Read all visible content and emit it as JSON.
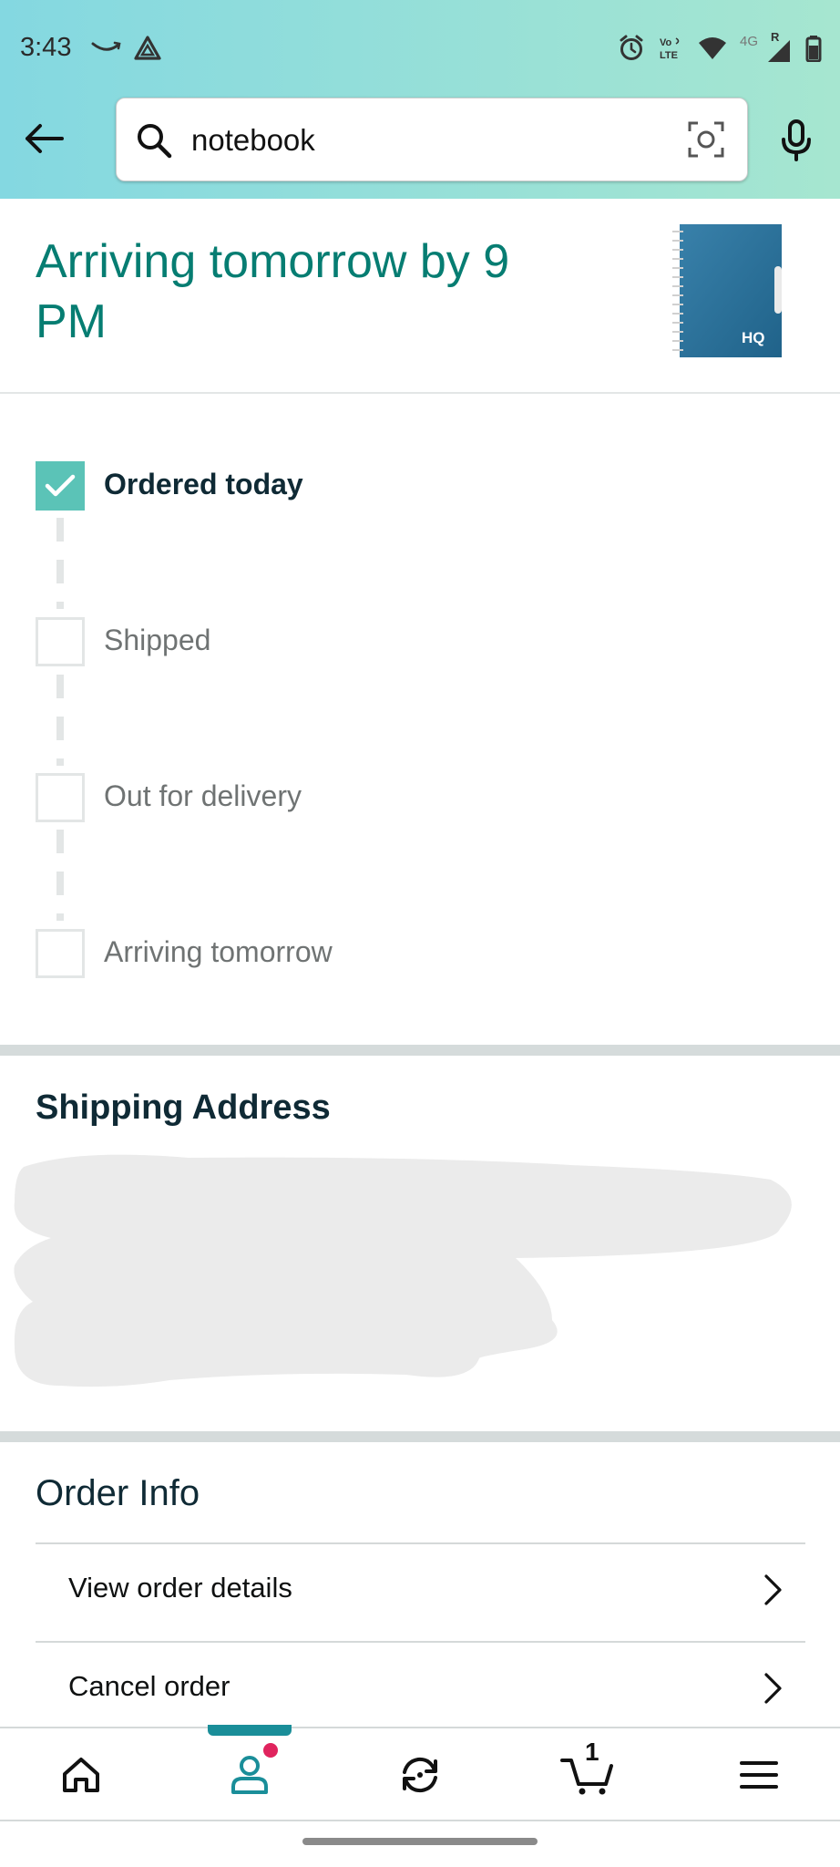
{
  "status_bar": {
    "time": "3:43",
    "network_badge": "4G",
    "roaming_badge": "R"
  },
  "search": {
    "value": "notebook",
    "placeholder": ""
  },
  "arrival": {
    "title": "Arriving tomorrow by 9 PM",
    "product_brand": "HQ"
  },
  "tracker": {
    "steps": [
      {
        "label": "Ordered today",
        "done": true
      },
      {
        "label": "Shipped",
        "done": false
      },
      {
        "label": "Out for delivery",
        "done": false
      },
      {
        "label": "Arriving tomorrow",
        "done": false
      }
    ]
  },
  "shipping": {
    "title": "Shipping Address"
  },
  "order_info": {
    "title": "Order Info",
    "rows": [
      {
        "label": "View order details"
      },
      {
        "label": "Cancel order"
      }
    ]
  },
  "bottom_nav": {
    "cart_count": "1",
    "active_tab": "account"
  },
  "colors": {
    "accent_teal": "#067d72",
    "check_teal": "#5bc3b7",
    "nav_indicator": "#1a8e99",
    "badge_pink": "#e0245e"
  }
}
